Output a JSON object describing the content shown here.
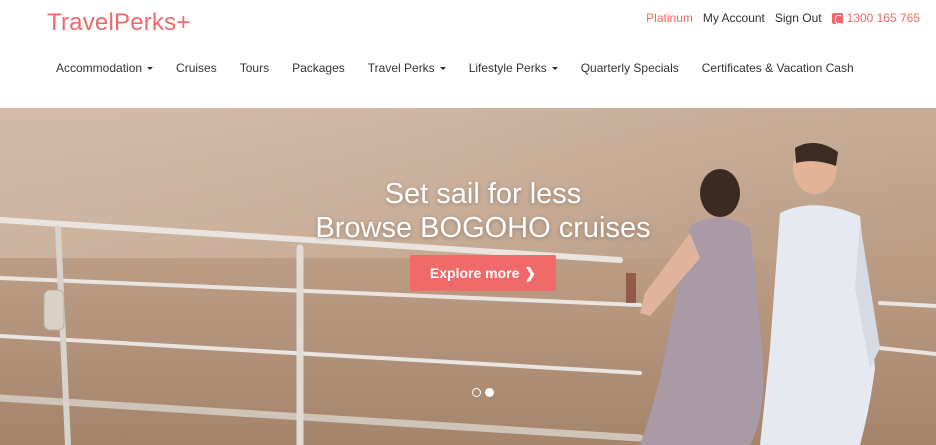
{
  "brand": {
    "logo_text": "TravelPerks+"
  },
  "topbar": {
    "tier": "Platinum",
    "my_account": "My Account",
    "sign_out": "Sign Out",
    "phone": "1300 165 765"
  },
  "nav": {
    "items": [
      {
        "label": "Accommodation",
        "dropdown": true
      },
      {
        "label": "Cruises",
        "dropdown": false
      },
      {
        "label": "Tours",
        "dropdown": false
      },
      {
        "label": "Packages",
        "dropdown": false
      },
      {
        "label": "Travel Perks",
        "dropdown": true
      },
      {
        "label": "Lifestyle Perks",
        "dropdown": true
      },
      {
        "label": "Quarterly Specials",
        "dropdown": false
      },
      {
        "label": "Certificates & Vacation Cash",
        "dropdown": false
      }
    ]
  },
  "hero": {
    "line1": "Set sail for less",
    "line2": "Browse BOGOHO cruises",
    "cta_label": "Explore more",
    "cta_icon": "chevron-right-icon",
    "slides": 2,
    "active_slide": 2
  },
  "colors": {
    "accent": "#ee6a6a",
    "cta": "#f06a6a"
  }
}
